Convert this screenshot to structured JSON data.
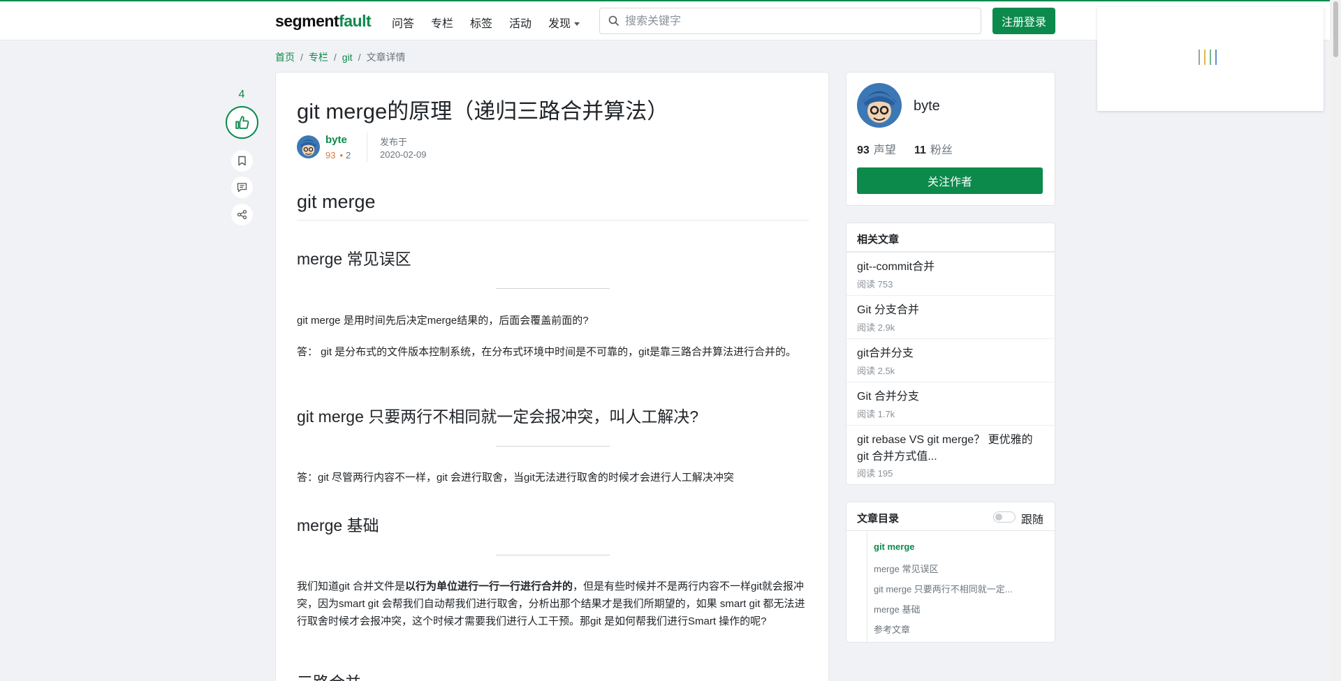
{
  "header": {
    "logo_prefix": "segment",
    "logo_suffix": "fault",
    "nav": [
      "问答",
      "专栏",
      "标签",
      "活动",
      "发现"
    ],
    "search_placeholder": "搜索关键字",
    "login_label": "注册登录"
  },
  "breadcrumb": [
    "首页",
    "专栏",
    "git",
    "文章详情"
  ],
  "vote": {
    "count": "4"
  },
  "article": {
    "title": "git merge的原理（递归三路合并算法）",
    "author": "byte",
    "reputation": "93",
    "badge_count": "2",
    "published_label": "发布于",
    "published_date": "2020-02-09",
    "h1": "git merge",
    "sections": [
      {
        "heading": "merge 常见误区"
      },
      {
        "heading": "git merge 只要两行不相同就一定会报冲突，叫人工解决?"
      },
      {
        "heading": "merge 基础"
      },
      {
        "heading": "三路合并"
      }
    ],
    "p1": "git merge 是用时间先后决定merge结果的，后面会覆盖前面的?",
    "p2": "答：  git 是分布式的文件版本控制系统，在分布式环境中时间是不可靠的，git是靠三路合并算法进行合并的。",
    "p3": "答：git 尽管两行内容不一样，git 会进行取舍，当git无法进行取舍的时候才会进行人工解决冲突",
    "p4_before": "我们知道git 合并文件是",
    "p4_bold": "以行为单位进行一行一行进行合并的",
    "p4_after": "，但是有些时候并不是两行内容不一样git就会报冲突，因为smart git 会帮我们自动帮我们进行取舍，分析出那个结果才是我们所期望的，如果 smart git 都无法进行取舍时候才会报冲突，这个时候才需要我们进行人工干预。那git 是如何帮我们进行Smart 操作的呢?"
  },
  "author_card": {
    "name": "byte",
    "reputation_value": "93",
    "reputation_label": "声望",
    "followers_value": "11",
    "followers_label": "粉丝",
    "follow_label": "关注作者"
  },
  "related": {
    "heading": "相关文章",
    "items": [
      {
        "title": "git--commit合并",
        "reads": "阅读 753"
      },
      {
        "title": "Git 分支合并",
        "reads": "阅读 2.9k"
      },
      {
        "title": "git合并分支",
        "reads": "阅读 2.5k"
      },
      {
        "title": "Git 合并分支",
        "reads": "阅读 1.7k"
      },
      {
        "title": "git rebase VS git merge？ 更优雅的 git 合并方式值...",
        "reads": "阅读 195"
      }
    ]
  },
  "toc": {
    "heading": "文章目录",
    "follow_label": "跟随",
    "items": [
      "git merge",
      "merge 常见误区",
      "git merge 只要两行不相同就一定...",
      "merge 基础",
      "参考文章"
    ]
  },
  "colors": {
    "brand": "#0b8a4b",
    "reputation": "#d97b3a"
  }
}
